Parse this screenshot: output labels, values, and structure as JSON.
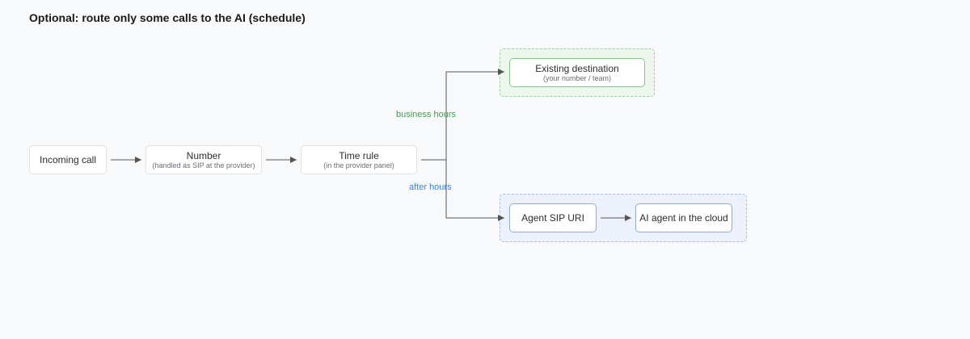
{
  "title": "Optional: route only some calls to the AI (schedule)",
  "nodes": {
    "incoming_call": {
      "label": "Incoming call"
    },
    "number": {
      "label": "Number",
      "sub": "(handled as SIP at the provider)"
    },
    "time_rule": {
      "label": "Time rule",
      "sub": "(in the provider panel)"
    },
    "existing_destination": {
      "label": "Existing destination",
      "sub": "(your number / team)"
    },
    "agent_sip_uri": {
      "label": "Agent SIP URI"
    },
    "ai_agent": {
      "label": "AI agent in the cloud"
    }
  },
  "edges": {
    "business_hours": "business hours",
    "after_hours": "after hours"
  },
  "colors": {
    "business_hours": "#3fa24a",
    "after_hours": "#3f7fd6",
    "connector": "#555555"
  }
}
